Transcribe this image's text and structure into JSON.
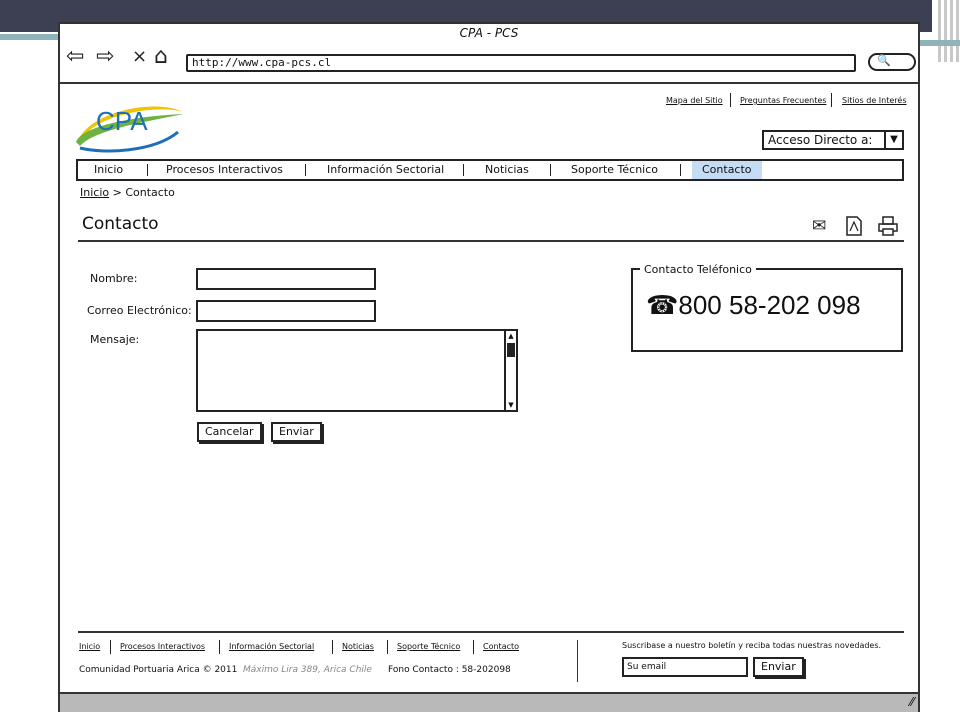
{
  "window": {
    "title": "CPA - PCS",
    "url": "http://www.cpa-pcs.cl"
  },
  "logo": {
    "text": "CPA"
  },
  "top_links": [
    "Mapa del Sitio",
    "Preguntas Frecuentes",
    "Sitios de Interés"
  ],
  "acceso": {
    "label": "Acceso Directo a:"
  },
  "menu": {
    "items": [
      "Inicio",
      "Procesos Interactivos",
      "Información Sectorial",
      "Noticias",
      "Soporte Técnico",
      "Contacto"
    ],
    "active": "Contacto"
  },
  "breadcrumb": {
    "home": "Inicio",
    "separator": ">",
    "current": "Contacto"
  },
  "page": {
    "title": "Contacto"
  },
  "form": {
    "name_label": "Nombre:",
    "email_label": "Correo Electrónico:",
    "message_label": "Mensaje:",
    "cancel_label": "Cancelar",
    "submit_label": "Enviar"
  },
  "contact_box": {
    "legend": "Contacto Teléfonico",
    "phone": "800 58-202 098"
  },
  "footer": {
    "links": [
      "Inicio",
      "Procesos Interactivos",
      "Información Sectorial",
      "Noticias",
      "Soporte Técnico",
      "Contacto"
    ],
    "org": "Comunidad Portuaria Arica © 2011",
    "address": "Máximo Lira 389, Arica Chile",
    "fono": "Fono Contacto : 58-202098",
    "newsletter_text": "Suscribase a nuestro boletín y reciba todas nuestras novedades.",
    "email_placeholder": "Su email",
    "submit_label": "Enviar"
  },
  "colors": {
    "active_tab": "#c5dcf5",
    "slide_band": "#3d4052",
    "logo_green": "#6db33f",
    "logo_yellow": "#f2c200",
    "logo_blue": "#1e6fb8"
  }
}
